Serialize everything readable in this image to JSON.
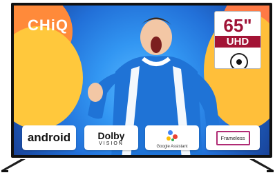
{
  "brand": {
    "logo": "CHiQ"
  },
  "badge": {
    "size": "65\"",
    "resolution": "UHD"
  },
  "features": {
    "android": "android",
    "dolby_main": "Dolby",
    "dolby_sub": "VISION",
    "google": "Google Assistant",
    "frameless": "Frameless"
  },
  "colors": {
    "screen_blue": "#2f8de8",
    "orange": "#ff8a3a",
    "yellow": "#ffc83c",
    "badge_red": "#a31335",
    "frame_accent": "#b02b74"
  },
  "icons": {
    "soccer_ball": "soccer-ball-icon",
    "google_assistant": "google-assistant-icon"
  }
}
